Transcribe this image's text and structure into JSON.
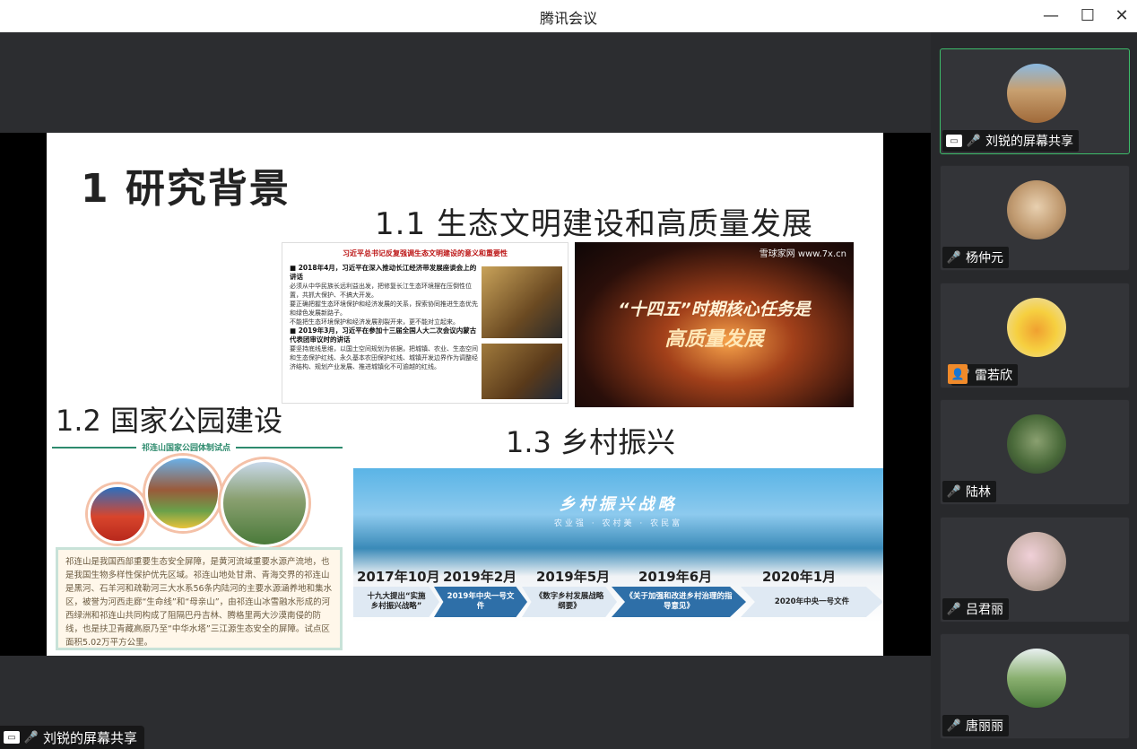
{
  "window": {
    "title": "腾讯会议",
    "minimize_glyph": "—",
    "maximize_glyph": "☐",
    "close_glyph": "✕"
  },
  "slide": {
    "heading1": "1 研究背景",
    "heading1_1": "1.1 生态文明建设和高质量发展",
    "heading1_2": "1.2 国家公园建设",
    "heading1_3": "1.3 乡村振兴",
    "doc": {
      "title": "习近平总书记反复强调生态文明建设的意义和重要性",
      "lines": [
        "■ 2018年4月，习近平在深入推动长江经济带发展座谈会上的讲话",
        "必须从中华民族长远利益出发，把修复长江生态环境摆在压倒性位置，共抓大保护、不搞大开发。",
        "要正确把握生态环境保护和经济发展的关系，探索协同推进生态优先和绿色发展新路子。",
        "不能把生态环境保护和经济发展割裂开来，更不能对立起来。",
        "■ 2019年3月，习近平在参加十三届全国人大二次会议内蒙古代表团审议时的讲话",
        "要坚持底线思维，以国土空间规划为依据，把城镇、农业、生态空间和生态保护红线、永久基本农田保护红线、城镇开发边界作为调整经济结构、规划产业发展、推进城镇化不可逾越的红线。"
      ]
    },
    "banner": {
      "brand": "雪球家网 www.7x.cn",
      "line1": "“十四五”时期核心任务是",
      "line2": "高质量发展"
    },
    "park": {
      "label": "祁连山国家公园体制试点",
      "text": "祁连山是我国西部重要生态安全屏障，是黄河流域重要水源产流地，也是我国生物多样性保护优先区域。祁连山地处甘肃、青海交界的祁连山是黑河、石羊河和疏勒河三大水系56条内陆河的主要水源涵养地和集水区，被誉为河西走廊“生命线”和“母亲山”，由祁连山冰雪融水形成的河西绿洲和祁连山共同构成了阻隔巴丹吉林、腾格里两大沙漠南侵的防线，也是扶卫青藏高原乃至“中华水塔”三江源生态安全的屏障。试点区面积5.02万平方公里。"
    },
    "rural": {
      "title": "乡村振兴战略",
      "subtitle": "农业强 · 农村美 · 农民富",
      "timeline": [
        {
          "year": "2017年10月",
          "text": "十九大提出“实施乡村振兴战略”"
        },
        {
          "year": "2019年2月",
          "text": "2019年中央一号文件"
        },
        {
          "year": "2019年5月",
          "text": "《数字乡村发展战略纲要》"
        },
        {
          "year": "2019年6月",
          "text": "《关于加强和改进乡村治理的指导意见》"
        },
        {
          "year": "2020年1月",
          "text": "2020年中央一号文件"
        }
      ]
    }
  },
  "stage_label": "刘锐的屏幕共享",
  "participants": [
    {
      "name": "刘锐的屏幕共享",
      "status": "speaking",
      "icon": "screen-share-icon"
    },
    {
      "name": "杨仲元",
      "status": "muted"
    },
    {
      "name": "雷若欣",
      "status": "muted",
      "icon": "user-icon"
    },
    {
      "name": "陆林",
      "status": "muted"
    },
    {
      "name": "吕君丽",
      "status": "muted"
    },
    {
      "name": "唐丽丽",
      "status": "muted"
    }
  ],
  "colors": {
    "accent_green": "#3dbd6a",
    "mute_red": "#ff4a4a"
  }
}
